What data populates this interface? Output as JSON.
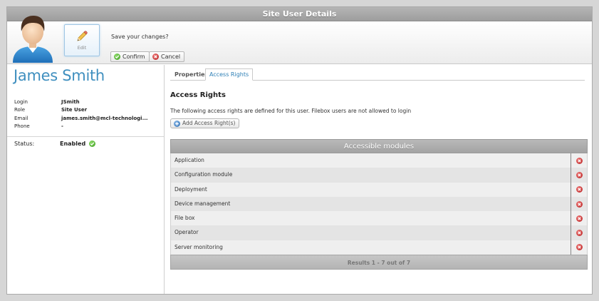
{
  "window": {
    "title": "Site User Details"
  },
  "toolbar": {
    "edit_label": "Edit",
    "save_question": "Save your changes?",
    "confirm_label": "Confirm",
    "cancel_label": "Cancel"
  },
  "user": {
    "name": "James Smith",
    "fields": [
      {
        "label": "Login",
        "value": "JSmith"
      },
      {
        "label": "Role",
        "value": "Site User"
      },
      {
        "label": "Email",
        "value": "james.smith@mcl-technologi..."
      },
      {
        "label": "Phone",
        "value": "-"
      }
    ],
    "status_label": "Status:",
    "status_value": "Enabled"
  },
  "tabs": [
    {
      "label": "Properties"
    },
    {
      "label": "Access Rights"
    }
  ],
  "access": {
    "title": "Access Rights",
    "description": "The following access rights are defined for this user. Filebox users are not allowed to login",
    "add_label": "Add Access Right(s)",
    "grid_header": "Accessible modules",
    "modules": [
      "Application",
      "Configuration module",
      "Deployment",
      "Device management",
      "File box",
      "Operator",
      "Server monitoring"
    ],
    "footer": "Results 1 - 7 out of 7"
  },
  "colors": {
    "accent": "#3f8fbf",
    "tab_active": "#2d7fb6",
    "ok": "#3c9c1e",
    "delete": "#b51d1d"
  }
}
